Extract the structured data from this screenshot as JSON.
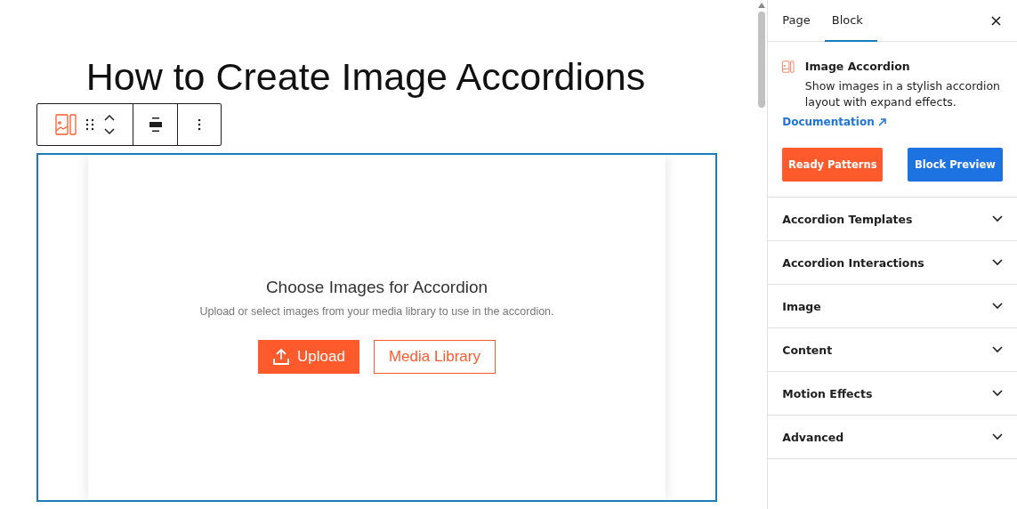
{
  "editor": {
    "title": "How to Create Image Accordions",
    "placeholder": {
      "heading": "Choose Images for Accordion",
      "description": "Upload or select images from your media library to use in the accordion.",
      "upload_button": "Upload",
      "library_button": "Media Library"
    }
  },
  "sidebar": {
    "tabs": [
      {
        "label": "Page",
        "selected": false
      },
      {
        "label": "Block",
        "selected": true
      }
    ],
    "block": {
      "name": "Image Accordion",
      "description": "Show images in a stylish accordion layout with expand effects.",
      "link": "Documentation",
      "buttons": [
        {
          "label": "Ready Patterns",
          "kind": "primary"
        },
        {
          "label": "Block Preview",
          "kind": "secondary"
        }
      ]
    },
    "panels": [
      {
        "label": "Accordion Templates",
        "expanded": false
      },
      {
        "label": "Accordion Interactions",
        "expanded": false
      },
      {
        "label": "Image",
        "expanded": false
      },
      {
        "label": "Content",
        "expanded": false
      },
      {
        "label": "Motion Effects",
        "expanded": false
      },
      {
        "label": "Advanced",
        "expanded": false
      }
    ]
  }
}
